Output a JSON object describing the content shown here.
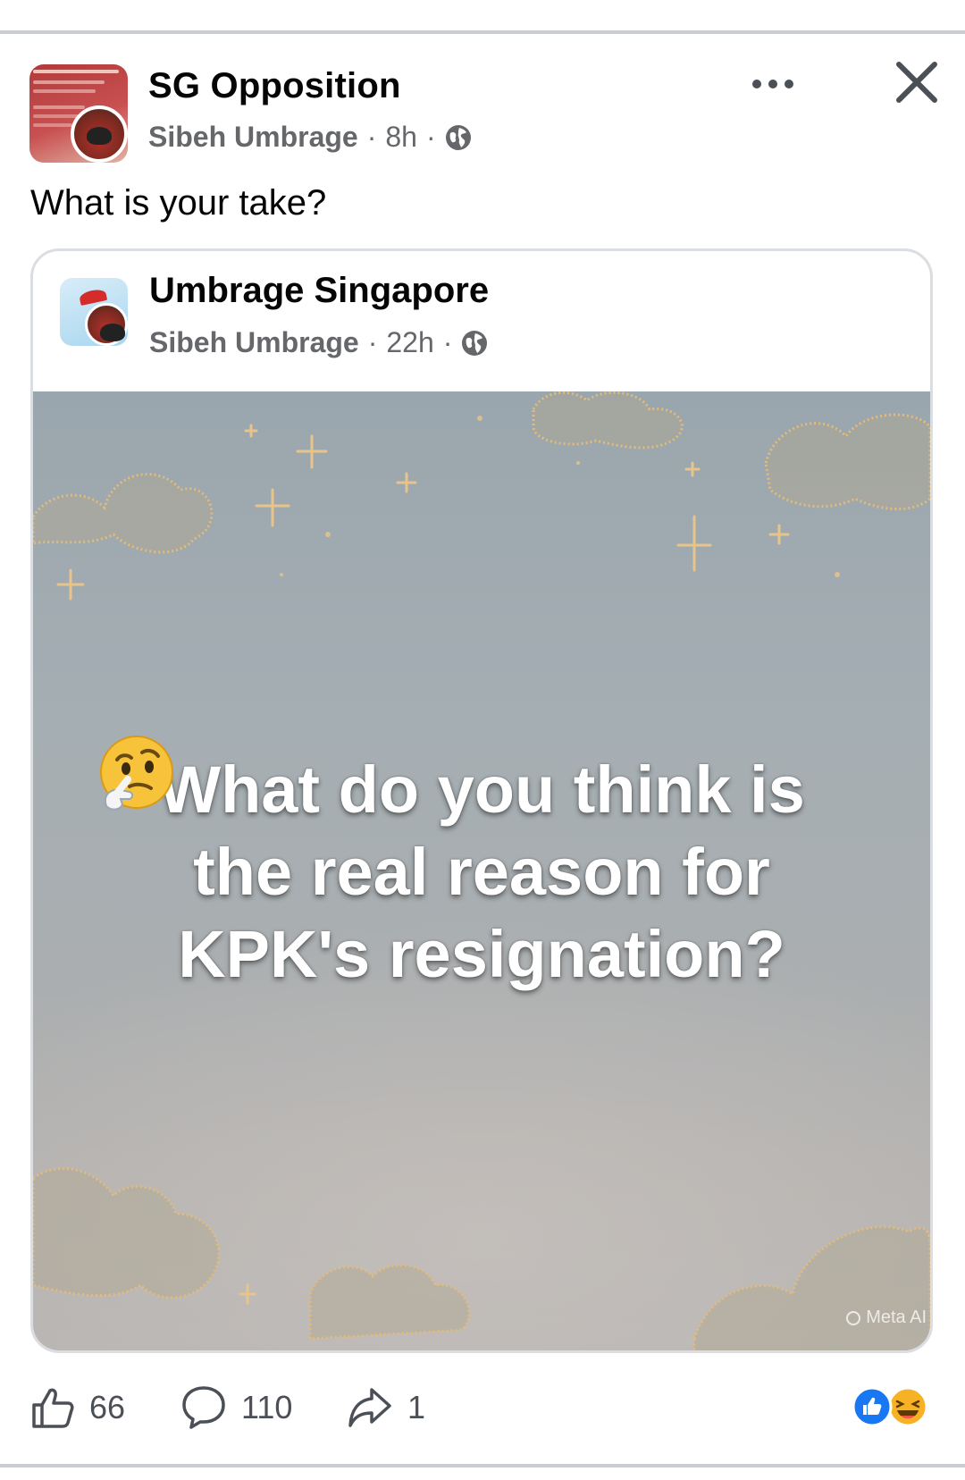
{
  "post": {
    "group_name": "SG Opposition",
    "author": "Sibeh Umbrage",
    "time": "8h",
    "separator": "·",
    "text": "What is your take?"
  },
  "shared": {
    "page_name": "Umbrage Singapore",
    "author": "Sibeh Umbrage",
    "time": "22h",
    "separator": "·",
    "image": {
      "caption_line1": "What do you think is",
      "caption_line2": "the real reason for",
      "caption_line3": "KPK's resignation?",
      "emoji": "thinking-face-icon",
      "watermark": "Meta AI"
    }
  },
  "actions": {
    "like_count": "66",
    "comment_count": "110",
    "share_count": "1"
  },
  "colors": {
    "text": "#050505",
    "muted": "#65676b",
    "like_blue": "#1877f2",
    "haha_yellow": "#f7b125"
  },
  "icons": [
    "globe-icon",
    "more-icon",
    "close-icon",
    "like-icon",
    "comment-icon",
    "share-icon",
    "like-reaction-icon",
    "haha-reaction-icon"
  ]
}
